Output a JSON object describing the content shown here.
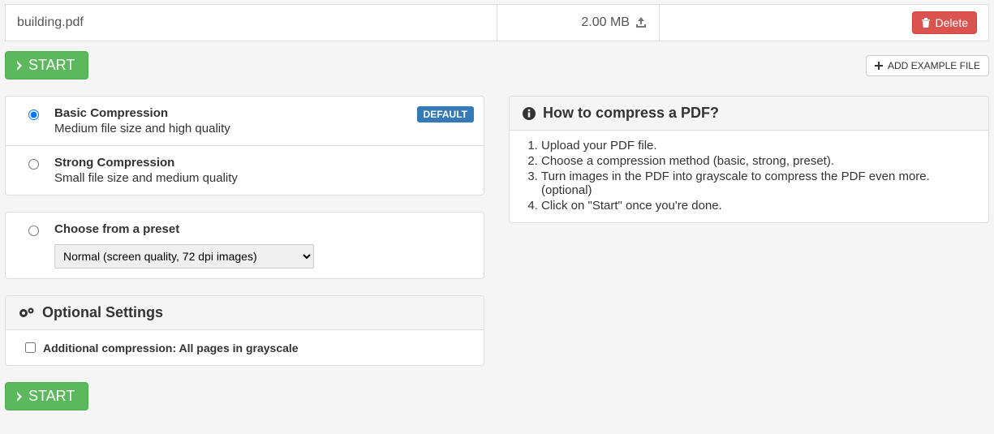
{
  "file": {
    "name": "building.pdf",
    "size": "2.00 MB",
    "delete_label": "Delete"
  },
  "actions": {
    "start_label": "START",
    "add_example_label": "ADD EXAMPLE FILE"
  },
  "compression": {
    "basic": {
      "title": "Basic Compression",
      "desc": "Medium file size and high quality",
      "badge": "DEFAULT"
    },
    "strong": {
      "title": "Strong Compression",
      "desc": "Small file size and medium quality"
    },
    "preset": {
      "title": "Choose from a preset",
      "selected": "Normal (screen quality, 72 dpi images)"
    }
  },
  "optional": {
    "heading": "Optional Settings",
    "grayscale_label": "Additional compression: All pages in grayscale"
  },
  "help": {
    "heading": "How to compress a PDF?",
    "steps": [
      "Upload your PDF file.",
      "Choose a compression method (basic, strong, preset).",
      "Turn images in the PDF into grayscale to compress the PDF even more. (optional)",
      "Click on \"Start\" once you're done."
    ]
  }
}
